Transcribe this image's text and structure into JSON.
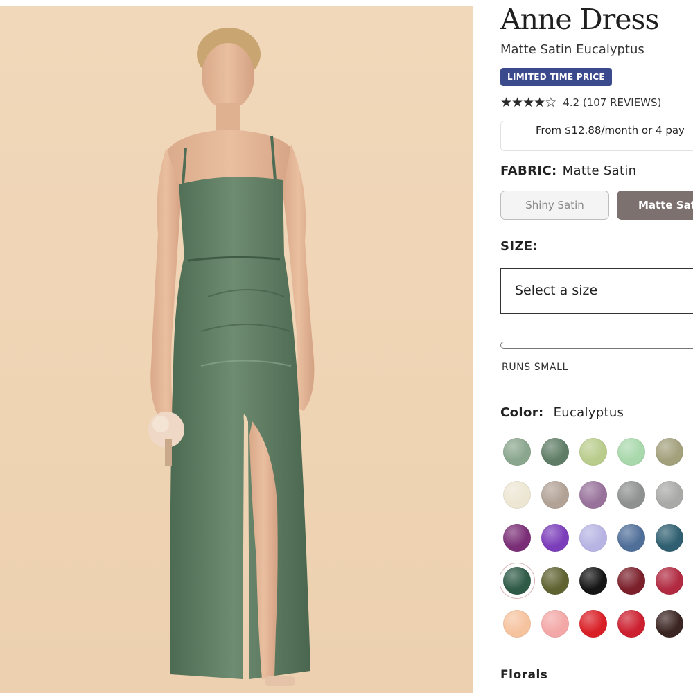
{
  "product": {
    "title": "Anne Dress",
    "subtitle": "Matte Satin Eucalyptus",
    "badge": "LIMITED TIME PRICE",
    "rating": {
      "value": 4.2,
      "stars_out_of": 5,
      "link_text": "4.2 (107 REVIEWS)"
    },
    "payment_text": "From $12.88/month or 4 pay"
  },
  "fabric": {
    "label": "FABRIC:",
    "selected": "Matte Satin",
    "options": [
      "Shiny Satin",
      "Matte Sat"
    ]
  },
  "size": {
    "label": "SIZE:",
    "placeholder": "Select a size",
    "fit_note": "RUNS SMALL"
  },
  "color": {
    "label": "Color:",
    "selected": "Eucalyptus",
    "swatches": [
      "#8aa68d",
      "#5f7d66",
      "#b9cc8c",
      "#a8d8ab",
      "#a3a07c",
      "#ede6d3",
      "#b2a296",
      "#98729b",
      "#8e9190",
      "#a9aaa7",
      "#7a2e76",
      "#7b3dba",
      "#b7b4e3",
      "#4f6e98",
      "#2f5f70",
      "#2e5a46",
      "#5f6231",
      "#151515",
      "#7b1f2a",
      "#b12a41",
      "#f6c39f",
      "#f3a7a6",
      "#d91f26",
      "#cc1f2f",
      "#3b2522"
    ],
    "selected_index": 15
  },
  "florals_label": "Florals",
  "colors": {
    "badge_bg": "#3b4a8c",
    "fabric_selected_bg": "#7d7170",
    "photo_bg": "#efd4b4",
    "dress": "#5c7a5f"
  }
}
